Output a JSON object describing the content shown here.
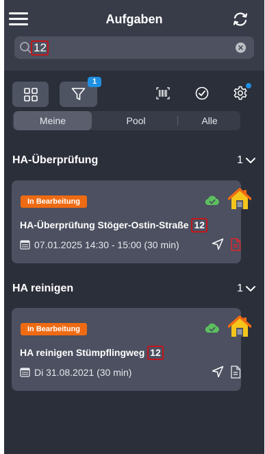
{
  "header": {
    "title": "Aufgaben"
  },
  "search": {
    "value": "12"
  },
  "toolbar": {
    "filter_badge": "1"
  },
  "tabs": [
    {
      "label": "Meine",
      "active": true
    },
    {
      "label": "Pool",
      "active": false
    },
    {
      "label": "Alle",
      "active": false
    }
  ],
  "groups": [
    {
      "title": "HA-Überprüfung",
      "count": "1",
      "task": {
        "status": "In Bearbeitung",
        "title_text": "HA-Überprüfung Stöger-Ostin-Straße",
        "title_highlight": "12",
        "date": "07.01.2025 14:30 - 15:00 (30 min)",
        "document_color": "#e0262b"
      }
    },
    {
      "title": "HA reinigen",
      "count": "1",
      "task": {
        "status": "In Bearbeitung",
        "title_text": "HA reinigen Stümpflingweg",
        "title_highlight": "12",
        "date": "Di 31.08.2021 (30 min)",
        "document_color": "#d6d8de"
      }
    }
  ],
  "colors": {
    "background": "#2b2f3a",
    "header": "#383c49",
    "card": "#4c5060",
    "status": "#ef6b13",
    "accent": "#1e8fe1",
    "cloud": "#5cc05f",
    "house_roof": "#ef6b13",
    "house_wall": "#f5c51b",
    "search_highlight": "#c4161c"
  },
  "icons": [
    "menu-icon",
    "sync-icon",
    "search-icon",
    "clear-icon",
    "grid-icon",
    "filter-icon",
    "barcode-icon",
    "check-circle-icon",
    "settings-icon",
    "chevron-down-icon",
    "cloud-check-icon",
    "house-icon",
    "calendar-icon",
    "navigation-icon",
    "document-icon"
  ]
}
